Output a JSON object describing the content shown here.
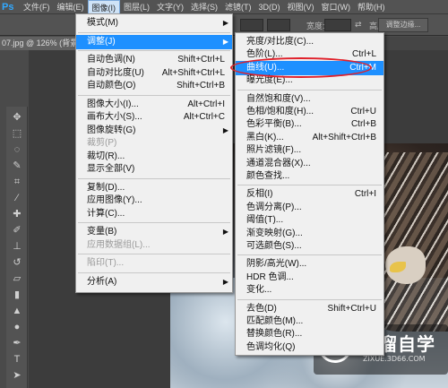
{
  "app": {
    "logo": "Ps"
  },
  "menubar": {
    "items": [
      "文件(F)",
      "编辑(E)",
      "图像(I)",
      "图层(L)",
      "文字(Y)",
      "选择(S)",
      "滤镜(T)",
      "3D(D)",
      "视图(V)",
      "窗口(W)",
      "帮助(H)"
    ],
    "active": "图像(I)"
  },
  "options": {
    "width_label": "宽度:",
    "height_label": "高度:",
    "refine_button": "调整边缘..."
  },
  "document": {
    "tab_title": "07.jpg @ 126% (背景 副本"
  },
  "image_menu": {
    "items": [
      {
        "label": "模式(M)",
        "shortcut": "",
        "submenu": true
      },
      {
        "sep": true
      },
      {
        "label": "调整(J)",
        "shortcut": "",
        "submenu": true,
        "highlighted": true
      },
      {
        "sep": true
      },
      {
        "label": "自动色调(N)",
        "shortcut": "Shift+Ctrl+L"
      },
      {
        "label": "自动对比度(U)",
        "shortcut": "Alt+Shift+Ctrl+L"
      },
      {
        "label": "自动颜色(O)",
        "shortcut": "Shift+Ctrl+B"
      },
      {
        "sep": true
      },
      {
        "label": "图像大小(I)...",
        "shortcut": "Alt+Ctrl+I"
      },
      {
        "label": "画布大小(S)...",
        "shortcut": "Alt+Ctrl+C"
      },
      {
        "label": "图像旋转(G)",
        "shortcut": "",
        "submenu": true
      },
      {
        "label": "裁剪(P)",
        "shortcut": "",
        "disabled": true
      },
      {
        "label": "裁切(R)...",
        "shortcut": ""
      },
      {
        "label": "显示全部(V)",
        "shortcut": ""
      },
      {
        "sep": true
      },
      {
        "label": "复制(D)...",
        "shortcut": ""
      },
      {
        "label": "应用图像(Y)...",
        "shortcut": ""
      },
      {
        "label": "计算(C)...",
        "shortcut": ""
      },
      {
        "sep": true
      },
      {
        "label": "变量(B)",
        "shortcut": "",
        "submenu": true
      },
      {
        "label": "应用数据组(L)...",
        "shortcut": "",
        "disabled": true
      },
      {
        "sep": true
      },
      {
        "label": "陷印(T)...",
        "shortcut": "",
        "disabled": true
      },
      {
        "sep": true
      },
      {
        "label": "分析(A)",
        "shortcut": "",
        "submenu": true
      }
    ]
  },
  "adjust_submenu": {
    "items": [
      {
        "label": "亮度/对比度(C)...",
        "shortcut": ""
      },
      {
        "label": "色阶(L)...",
        "shortcut": "Ctrl+L"
      },
      {
        "label": "曲线(U)...",
        "shortcut": "Ctrl+M",
        "highlighted": true
      },
      {
        "label": "曝光度(E)...",
        "shortcut": ""
      },
      {
        "sep": true
      },
      {
        "label": "自然饱和度(V)...",
        "shortcut": ""
      },
      {
        "label": "色相/饱和度(H)...",
        "shortcut": "Ctrl+U"
      },
      {
        "label": "色彩平衡(B)...",
        "shortcut": "Ctrl+B"
      },
      {
        "label": "黑白(K)...",
        "shortcut": "Alt+Shift+Ctrl+B"
      },
      {
        "label": "照片滤镜(F)...",
        "shortcut": ""
      },
      {
        "label": "通道混合器(X)...",
        "shortcut": ""
      },
      {
        "label": "颜色查找...",
        "shortcut": ""
      },
      {
        "sep": true
      },
      {
        "label": "反相(I)",
        "shortcut": "Ctrl+I"
      },
      {
        "label": "色调分离(P)...",
        "shortcut": ""
      },
      {
        "label": "阈值(T)...",
        "shortcut": ""
      },
      {
        "label": "渐变映射(G)...",
        "shortcut": ""
      },
      {
        "label": "可选颜色(S)...",
        "shortcut": ""
      },
      {
        "sep": true
      },
      {
        "label": "阴影/高光(W)...",
        "shortcut": ""
      },
      {
        "label": "HDR 色调...",
        "shortcut": ""
      },
      {
        "label": "变化...",
        "shortcut": ""
      },
      {
        "sep": true
      },
      {
        "label": "去色(D)",
        "shortcut": "Shift+Ctrl+U"
      },
      {
        "label": "匹配颜色(M)...",
        "shortcut": ""
      },
      {
        "label": "替换颜色(R)...",
        "shortcut": ""
      },
      {
        "label": "色调均化(Q)",
        "shortcut": ""
      }
    ]
  },
  "watermark": {
    "title": "溜溜自学",
    "url": "ZIXUE.3D66.COM"
  },
  "colors": {
    "highlight": "#1e90ff",
    "annotation": "#e0202a",
    "menu_bg": "#f0f0f0"
  }
}
